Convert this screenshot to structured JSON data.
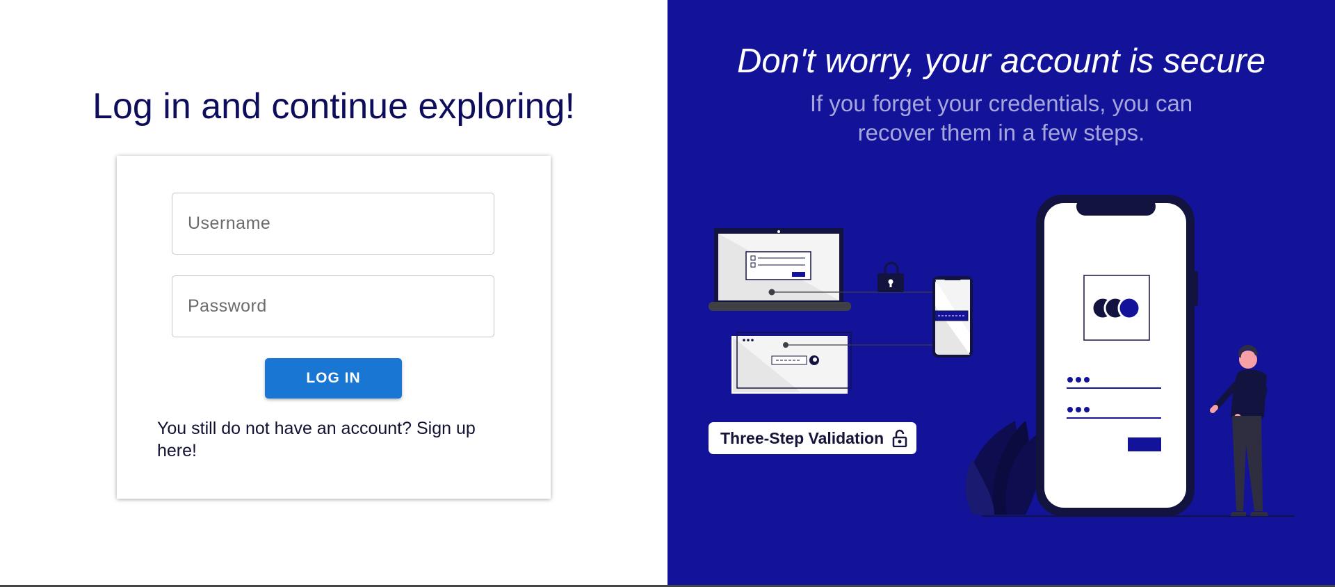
{
  "login": {
    "title": "Log in and continue exploring!",
    "username_placeholder": "Username",
    "password_placeholder": "Password",
    "login_button": "LOG IN",
    "signup_text": "You still do not have an account? Sign up here!"
  },
  "promo": {
    "title": "Don't worry, your account is secure",
    "subtitle": "If you forget your credentials, you can recover them in a few steps.",
    "badge_label": "Three-Step Validation"
  },
  "colors": {
    "promo_background": "#13139a",
    "primary_button": "#1976d2",
    "dark_navy": "#0d0d5c"
  },
  "icons": {
    "badge": "unlock-icon",
    "illustration_lock": "padlock-icon"
  }
}
